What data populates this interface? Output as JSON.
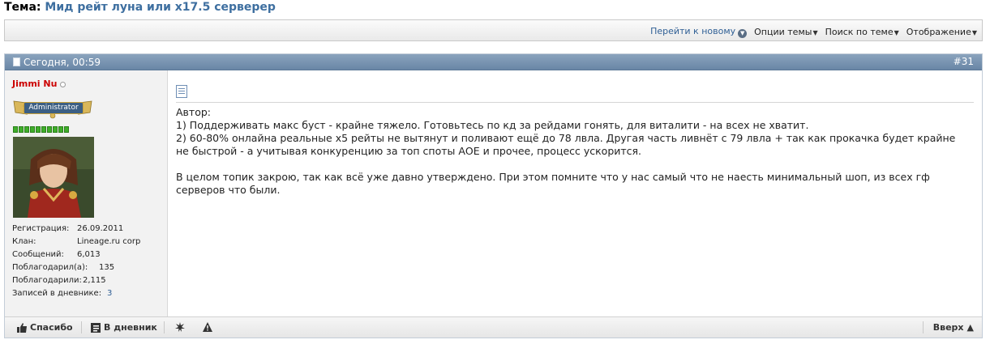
{
  "topic": {
    "label": "Тема:",
    "name": "Мид рейт луна или х17.5 серверер"
  },
  "toolbar": {
    "go_new": "Перейти к новому",
    "options": "Опции темы",
    "search": "Поиск по теме",
    "display": "Отображение"
  },
  "post": {
    "date": "Сегодня, 00:59",
    "number": "#31",
    "author": {
      "name": "Jimmi Nu",
      "rank": "Administrator",
      "reputation_level": 0.8,
      "details": [
        {
          "key": "Регистрация:",
          "value": "26.09.2011"
        },
        {
          "key": "Клан:",
          "value": "Lineage.ru corp"
        },
        {
          "key": "Сообщений:",
          "value": "6,013"
        },
        {
          "key": "Поблагодарил(а):",
          "value": "135"
        },
        {
          "key": "Поблагодарили:",
          "value": "2,115"
        },
        {
          "key": "Записей в дневнике:",
          "value": "3"
        }
      ]
    },
    "message": {
      "line1": "Автор:",
      "line2": "1) Поддерживать макс буст - крайне тяжело. Готовьтесь по кд за рейдами гонять, для виталити - на всех не хватит.",
      "line3": "2) 60-80% онлайна реальные х5 рейты не вытянут и поливают ещё до 78 лвла. Другая часть ливнёт с 79 лвла + так как прокачка будет крайне не быстрой - а учитывая конкуренцию за топ споты АОЕ и прочее, процесс ускорится.",
      "line4": "В целом топик закрою, так как всё уже давно утверждено. При этом помните что у нас самый что не наесть минимальный шоп, из всех гф серверов что были."
    },
    "footer": {
      "thanks": "Спасибо",
      "diary": "В дневник",
      "top": "Вверх"
    }
  },
  "colors": {
    "header_bar": "#7592b1",
    "username": "#cc0000",
    "link": "#2f5f95",
    "reputation": "#3fae2a"
  }
}
